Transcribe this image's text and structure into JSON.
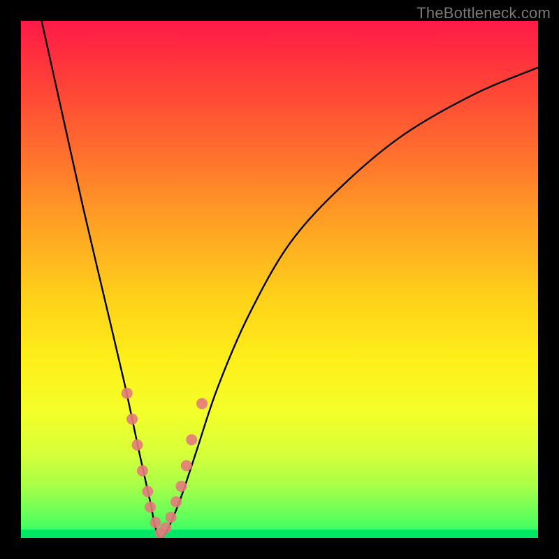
{
  "watermark": "TheBottleneck.com",
  "chart_data": {
    "type": "line",
    "title": "",
    "xlabel": "",
    "ylabel": "",
    "xlim": [
      0,
      100
    ],
    "ylim": [
      0,
      100
    ],
    "grid": false,
    "curve_minimum_x": 27,
    "curve_minimum_y": 0,
    "series": [
      {
        "name": "bottleneck-curve",
        "x": [
          4,
          8,
          12,
          16,
          20,
          23,
          25,
          26,
          27,
          28,
          29,
          31,
          34,
          38,
          44,
          52,
          62,
          74,
          88,
          100
        ],
        "y": [
          100,
          82,
          64,
          47,
          30,
          16,
          7,
          2,
          0,
          1,
          3,
          8,
          17,
          29,
          43,
          57,
          68,
          78,
          86,
          91
        ]
      },
      {
        "name": "sample-markers",
        "type": "scatter",
        "color": "#e37b7b",
        "x": [
          20.5,
          21.5,
          22.5,
          23.5,
          24.5,
          25,
          26,
          27,
          28,
          29,
          30,
          31,
          32,
          33,
          35
        ],
        "y": [
          28,
          23,
          18,
          13,
          9,
          6,
          3,
          1,
          2,
          4,
          7,
          10,
          14,
          19,
          26
        ]
      }
    ],
    "background_gradient": {
      "orientation": "vertical",
      "stops": [
        {
          "pos": 0.0,
          "color": "#ff1a47"
        },
        {
          "pos": 0.25,
          "color": "#ff6d2e"
        },
        {
          "pos": 0.55,
          "color": "#ffd21a"
        },
        {
          "pos": 0.8,
          "color": "#e9ff30"
        },
        {
          "pos": 1.0,
          "color": "#00e864"
        }
      ]
    }
  }
}
